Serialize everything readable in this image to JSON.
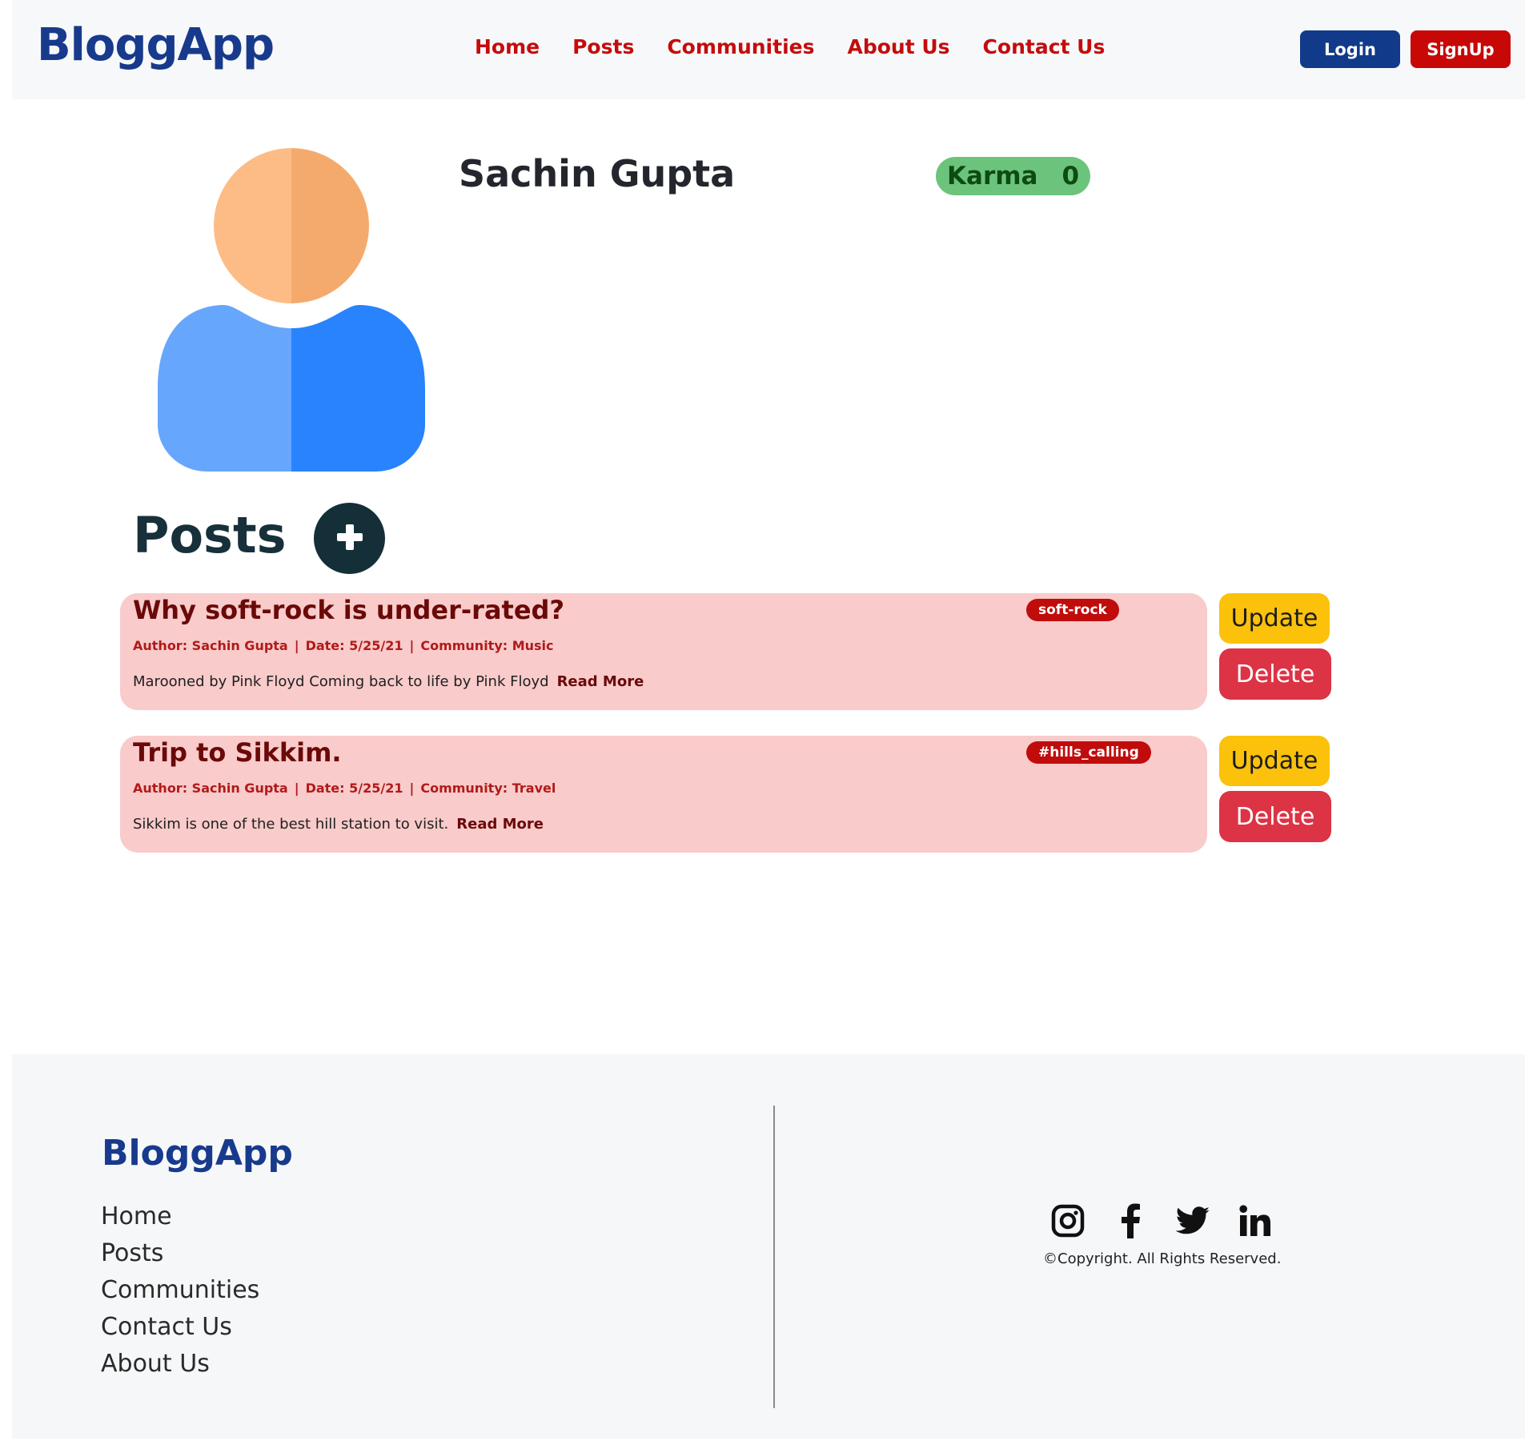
{
  "navbar": {
    "brand": "BloggApp",
    "links": [
      "Home",
      "Posts",
      "Communities",
      "About Us",
      "Contact Us"
    ],
    "login_label": "Login",
    "signup_label": "SignUp"
  },
  "profile": {
    "name": "Sachin Gupta",
    "karma_label": "Karma",
    "karma_value": "0"
  },
  "posts_section": {
    "heading": "Posts",
    "add_icon": "plus-icon"
  },
  "posts": [
    {
      "title": "Why soft-rock is under-rated?",
      "tag": "soft-rock",
      "author": "Author: Sachin Gupta",
      "date": "Date: 5/25/21",
      "community": "Community: Music",
      "body": "Marooned by Pink Floyd Coming back to life by Pink Floyd",
      "read_more": "Read More",
      "update_label": "Update",
      "delete_label": "Delete"
    },
    {
      "title": "Trip to Sikkim.",
      "tag": "#hills_calling",
      "author": "Author: Sachin Gupta",
      "date": "Date: 5/25/21",
      "community": "Community: Travel",
      "body": "Sikkim is one of the best hill station to visit.",
      "read_more": "Read More",
      "update_label": "Update",
      "delete_label": "Delete"
    }
  ],
  "meta_separator": "|",
  "footer": {
    "brand": "BloggApp",
    "links": [
      "Home",
      "Posts",
      "Communities",
      "Contact Us",
      "About Us"
    ],
    "social_icons": [
      "instagram-icon",
      "facebook-icon",
      "twitter-icon",
      "linkedin-icon"
    ],
    "copyright": "©Copyright. All Rights Reserved."
  },
  "colors": {
    "brand_blue": "#173a8c",
    "nav_red": "#c40c0c",
    "karma_green": "#6cc47c",
    "card_pink": "#f9cbcb",
    "update_yellow": "#fbc10b",
    "delete_red": "#dc3345"
  }
}
